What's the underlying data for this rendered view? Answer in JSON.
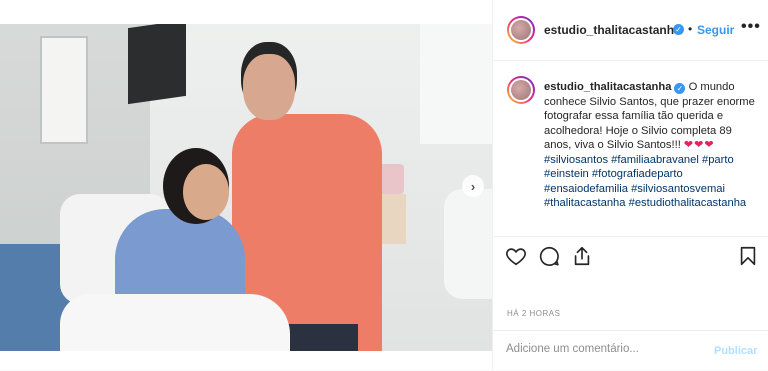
{
  "post": {
    "username": "estudio_thalitacastanha",
    "follow_label": "Seguir",
    "separator": "•",
    "more_label": "•••",
    "verified_glyph": "✓",
    "caption": {
      "username": "estudio_thalitacastanha",
      "text": "O mundo conhece Silvio Santos, que prazer enorme fotografar essa família tão querida e acolhedora! Hoje o Silvio completa 89 anos, viva o Silvio Santos!!!",
      "hearts": "❤❤❤",
      "hashtags": [
        "#silviosantos",
        "#familiaabravanel",
        "#parto",
        "#einstein",
        "#fotografiadeparto",
        "#ensaiodefamilia",
        "#silviosantosvemai",
        "#thalitacastanha",
        "#estudiothalitacastanha"
      ]
    },
    "timestamp": "HÁ 2 HORAS",
    "comment_placeholder": "Adicione um comentário...",
    "publish_label": "Publicar",
    "next_glyph": "›",
    "icons": {
      "like": "heart-icon",
      "comment": "comment-icon",
      "share": "share-icon",
      "save": "bookmark-icon"
    },
    "colors": {
      "link_blue": "#3897f0",
      "hashtag": "#003569",
      "heart_red": "#e0245e",
      "publish_disabled": "#b2dffc"
    }
  }
}
